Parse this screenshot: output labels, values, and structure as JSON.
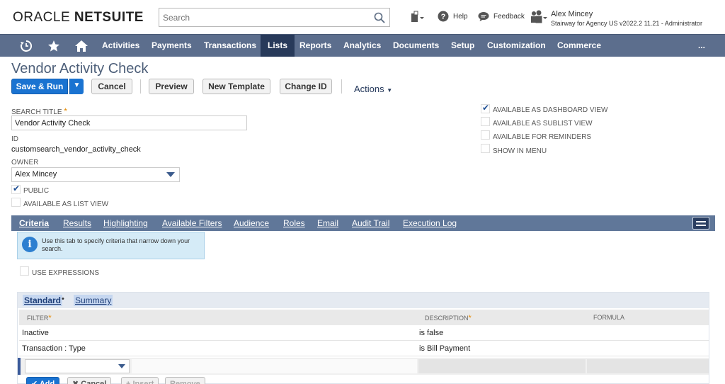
{
  "header": {
    "logo_oracle": "ORACLE",
    "logo_netsuite": "NETSUITE",
    "search_placeholder": "Search",
    "help": "Help",
    "feedback": "Feedback",
    "user_name": "Alex Mincey",
    "user_role": "Stairway for Agency US v2022.2 11.21 - Administrator"
  },
  "nav": {
    "items": [
      "Activities",
      "Payments",
      "Transactions",
      "Lists",
      "Reports",
      "Analytics",
      "Documents",
      "Setup",
      "Customization",
      "Commerce"
    ],
    "active": "Lists",
    "more": "..."
  },
  "page": {
    "title": "Vendor Activity Check",
    "buttons": {
      "save_run": "Save & Run",
      "cancel": "Cancel",
      "preview": "Preview",
      "new_template": "New Template",
      "change_id": "Change ID",
      "actions": "Actions"
    }
  },
  "form": {
    "search_title_label": "SEARCH TITLE",
    "search_title_value": "Vendor Activity Check",
    "id_label": "ID",
    "id_value": "customsearch_vendor_activity_check",
    "owner_label": "OWNER",
    "owner_value": "Alex Mincey",
    "public_label": "PUBLIC",
    "public_checked": true,
    "list_view_label": "AVAILABLE AS LIST VIEW",
    "list_view_checked": false,
    "dashboard_label": "AVAILABLE AS DASHBOARD VIEW",
    "dashboard_checked": true,
    "sublist_label": "AVAILABLE AS SUBLIST VIEW",
    "sublist_checked": false,
    "reminders_label": "AVAILABLE FOR REMINDERS",
    "reminders_checked": false,
    "show_menu_label": "SHOW IN MENU",
    "show_menu_checked": false
  },
  "subtabs": {
    "items": [
      "Criteria",
      "Results",
      "Highlighting",
      "Available Filters",
      "Audience",
      "Roles",
      "Email",
      "Audit Trail",
      "Execution Log"
    ],
    "active": "Criteria"
  },
  "info": {
    "text": "Use this tab to specify criteria that narrow down your search."
  },
  "use_expressions_label": "USE EXPRESSIONS",
  "criteria": {
    "tabs": [
      "Standard",
      "Summary"
    ],
    "tab_separator": "•",
    "columns": [
      "FILTER",
      "DESCRIPTION",
      "FORMULA"
    ],
    "rows": [
      {
        "filter": "Inactive",
        "description": "is false"
      },
      {
        "filter": "Transaction : Type",
        "description": "is Bill Payment"
      }
    ],
    "buttons": {
      "add": "✔ Add",
      "cancel": "✖ Cancel",
      "insert": "+ Insert",
      "remove": "Remove"
    }
  }
}
